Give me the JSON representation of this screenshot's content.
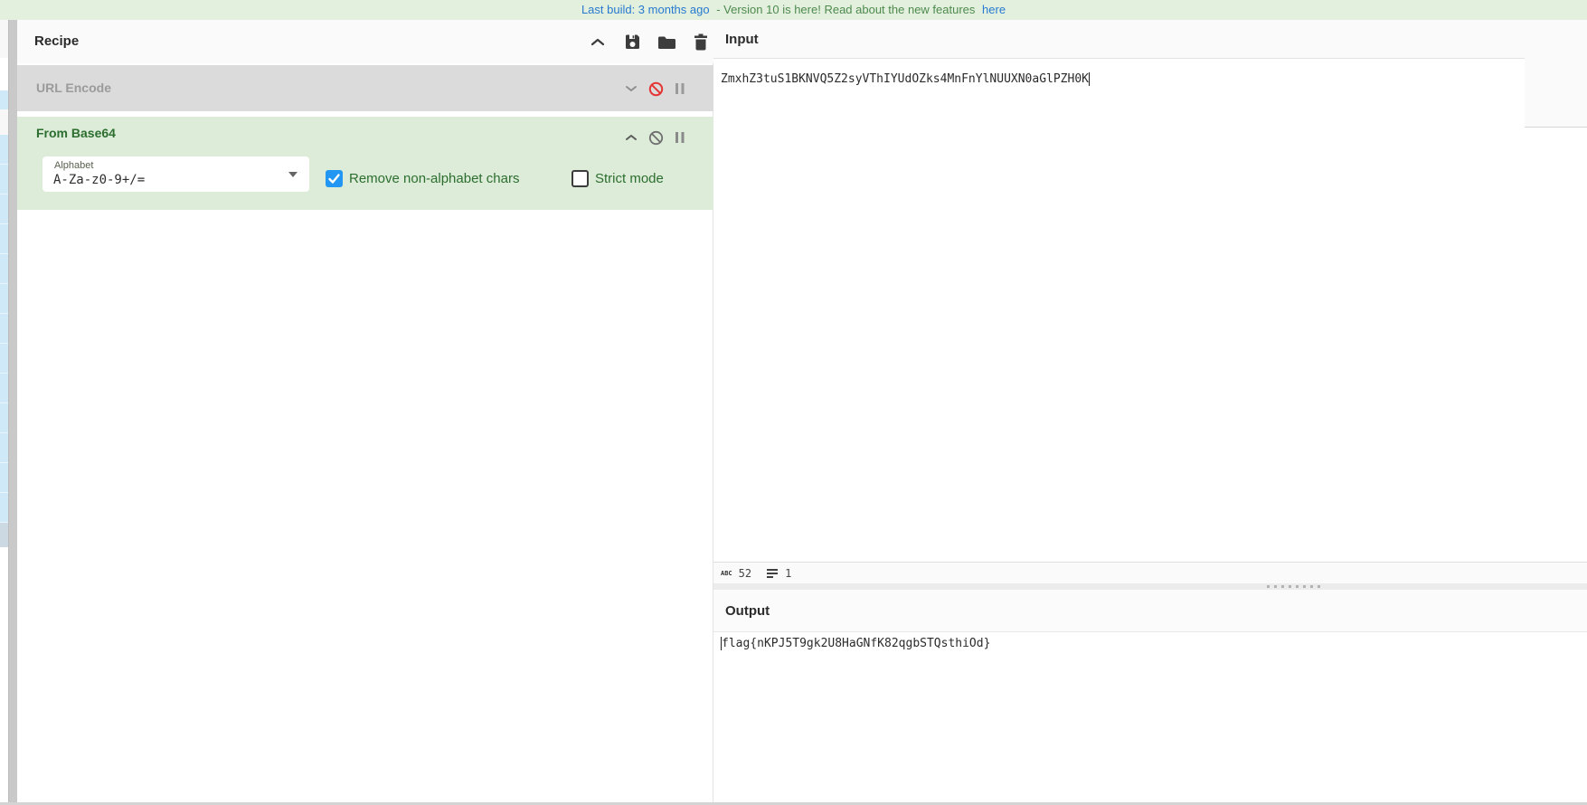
{
  "banner": {
    "last_build_link": "Last build: 3 months ago",
    "message": "- Version 10 is here! Read about the new features",
    "here_link": "here"
  },
  "recipe": {
    "title": "Recipe",
    "operations": [
      {
        "name": "URL Encode",
        "disabled": true
      },
      {
        "name": "From Base64",
        "disabled": false
      }
    ],
    "from_base64_args": {
      "alphabet_label": "Alphabet",
      "alphabet_value": "A-Za-z0-9+/=",
      "remove_non_alphabet_label": "Remove non-alphabet chars",
      "remove_non_alphabet_checked": true,
      "strict_mode_label": "Strict mode",
      "strict_mode_checked": false
    }
  },
  "input": {
    "title": "Input",
    "text": "ZmxhZ3tuS1BKNVQ5Z2syVThIYUdOZks4MnFnYlNUUXN0aGlPZH0K",
    "status": {
      "char_count_icon": "ABC",
      "char_count": "52",
      "line_count": "1"
    }
  },
  "output": {
    "title": "Output",
    "text": "flag{nKPJ5T9gk2U8HaGNfK82qgbSTQsthiOd}"
  },
  "colors": {
    "banner_bg": "#e2f0dd",
    "link_blue": "#2879d0",
    "op_green_bg": "#dcecd8",
    "op_green_text": "#2c6e2f",
    "checkbox_blue": "#2196f3",
    "disable_red": "#e53434"
  }
}
